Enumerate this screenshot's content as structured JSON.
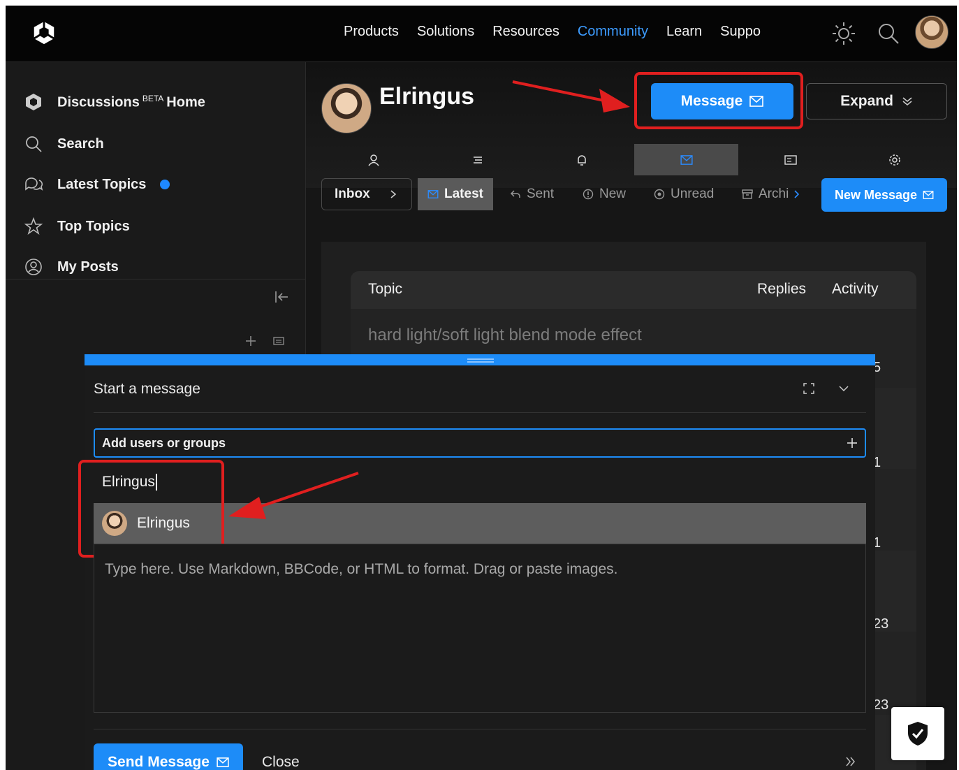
{
  "nav": {
    "links": [
      "Products",
      "Solutions",
      "Resources",
      "Community",
      "Learn",
      "Suppo"
    ],
    "active": "Community"
  },
  "sidebar": {
    "items": [
      {
        "label": "Discussions",
        "badge": "BETA",
        "suffix": "Home",
        "icon": "unity-logo-icon"
      },
      {
        "label": "Search",
        "icon": "search-icon"
      },
      {
        "label": "Latest Topics",
        "icon": "chat-bubbles-icon",
        "has_dot": true
      },
      {
        "label": "Top Topics",
        "icon": "star-icon"
      },
      {
        "label": "My Posts",
        "icon": "user-circle-icon"
      }
    ]
  },
  "profile": {
    "name": "Elringus",
    "message_label": "Message",
    "expand_label": "Expand"
  },
  "subnav": {
    "inbox_label": "Inbox",
    "items": [
      "Latest",
      "Sent",
      "New",
      "Unread",
      "Archi"
    ],
    "selected": "Latest",
    "new_message_label": "New Message"
  },
  "topic_list": {
    "headers": [
      "Topic",
      "Replies",
      "Activity"
    ],
    "first_topic": "hard light/soft light blend mode effect",
    "row_numbers": [
      "5",
      "1",
      "1",
      "23",
      "23"
    ]
  },
  "composer": {
    "title": "Start a message",
    "add_users_label": "Add users or groups",
    "typed_value": "Elringus",
    "suggestion": "Elringus",
    "placeholder": "Type here. Use Markdown, BBCode, or HTML to format. Drag or paste images.",
    "send_label": "Send Message",
    "close_label": "Close"
  },
  "colors": {
    "accent": "#1d8cf8",
    "highlight": "#e01f1f"
  }
}
